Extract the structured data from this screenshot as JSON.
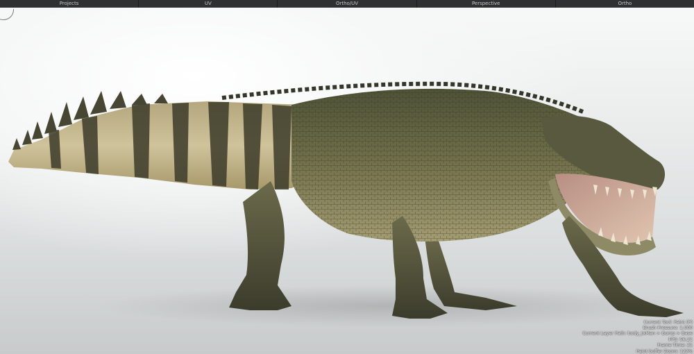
{
  "tabs": [
    {
      "label": "Projects"
    },
    {
      "label": "UV"
    },
    {
      "label": "Ortho/UV"
    },
    {
      "label": "Perspective"
    },
    {
      "label": "Ortho"
    }
  ],
  "hud": {
    "current_tool": "Current Tool: Paint (P)",
    "brush_pressure": "Brush Pressure: 1.000",
    "layer_path": "Current Layer Path: body_txMan > Bump > Base",
    "fps": "FPS: 56.21",
    "frame_time": "Frame Time: 21",
    "paint_buffer_zoom": "Paint buffer Zoom: 122%"
  },
  "viewport": {
    "model": "crocodile-3d-model"
  }
}
